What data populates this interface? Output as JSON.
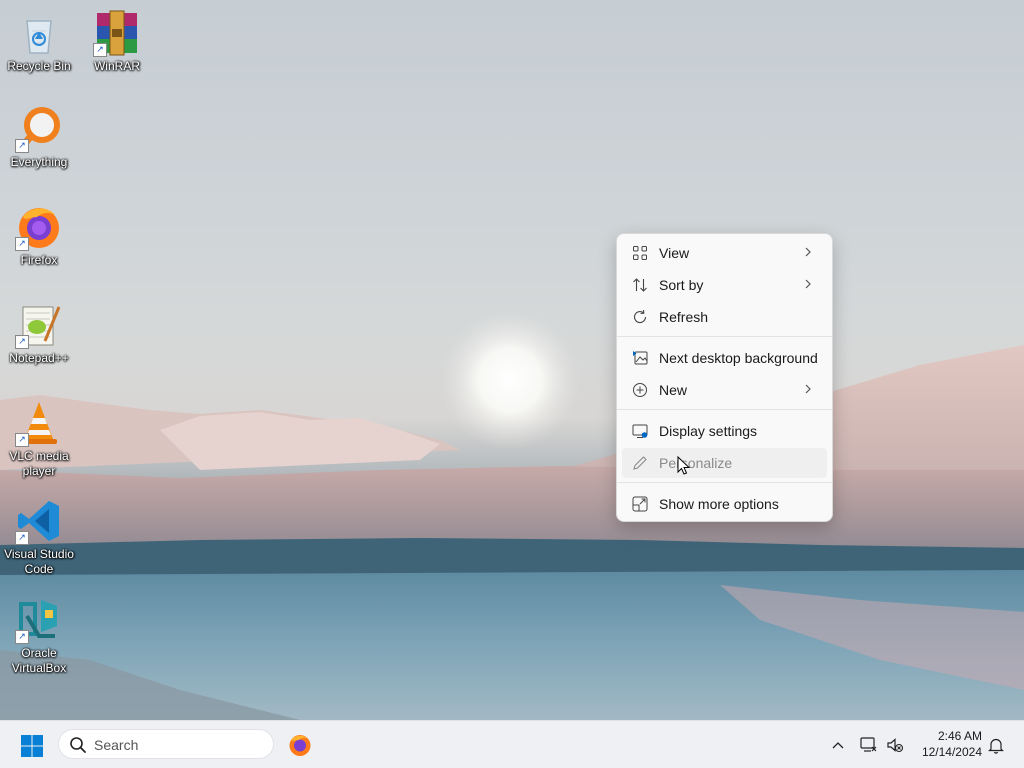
{
  "desktop": {
    "icons": [
      {
        "label": "Recycle Bin",
        "icon": "recycle-bin-icon",
        "shortcut": false
      },
      {
        "label": "WinRAR",
        "icon": "winrar-icon",
        "shortcut": true
      },
      {
        "label": "Everything",
        "icon": "everything-icon",
        "shortcut": true
      },
      {
        "label": "Firefox",
        "icon": "firefox-icon",
        "shortcut": true
      },
      {
        "label": "Notepad++",
        "icon": "notepad-plus-plus-icon",
        "shortcut": true
      },
      {
        "label": "VLC media player",
        "icon": "vlc-icon",
        "shortcut": true
      },
      {
        "label": "Visual Studio Code",
        "icon": "vscode-icon",
        "shortcut": true
      },
      {
        "label": "Oracle VirtualBox",
        "icon": "virtualbox-icon",
        "shortcut": true
      }
    ]
  },
  "context_menu": {
    "items": [
      {
        "label": "View",
        "icon": "grid-icon",
        "submenu": true
      },
      {
        "label": "Sort by",
        "icon": "sort-icon",
        "submenu": true
      },
      {
        "label": "Refresh",
        "icon": "refresh-icon",
        "submenu": false
      },
      {
        "label": "Next desktop background",
        "icon": "next-background-icon",
        "submenu": false
      },
      {
        "label": "New",
        "icon": "plus-circle-icon",
        "submenu": true
      },
      {
        "label": "Display settings",
        "icon": "display-settings-icon",
        "submenu": false
      },
      {
        "label": "Personalize",
        "icon": "pen-icon",
        "submenu": false,
        "hovered": true
      },
      {
        "label": "Show more options",
        "icon": "show-more-icon",
        "submenu": false
      }
    ]
  },
  "taskbar": {
    "search_placeholder": "Search",
    "time": "2:46 AM",
    "date": "12/14/2024",
    "accent": "#0078d4"
  }
}
